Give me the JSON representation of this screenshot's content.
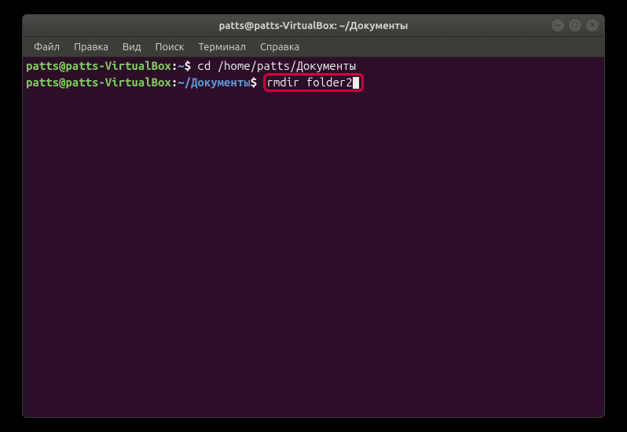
{
  "window": {
    "title": "patts@patts-VirtualBox: ~/Документы"
  },
  "menubar": {
    "items": [
      "Файл",
      "Правка",
      "Вид",
      "Поиск",
      "Терминал",
      "Справка"
    ]
  },
  "terminal": {
    "lines": [
      {
        "user_host": "patts@patts-VirtualBox",
        "separator": ":",
        "path": "~",
        "prompt": "$",
        "command": " cd /home/patts/Документы"
      },
      {
        "user_host": "patts@patts-VirtualBox",
        "separator": ":",
        "path": "~/Документы",
        "prompt": "$",
        "command_highlighted": "rmdir folder2"
      }
    ]
  },
  "win_controls": {
    "minimize": "–",
    "maximize": "□",
    "close": "×"
  }
}
